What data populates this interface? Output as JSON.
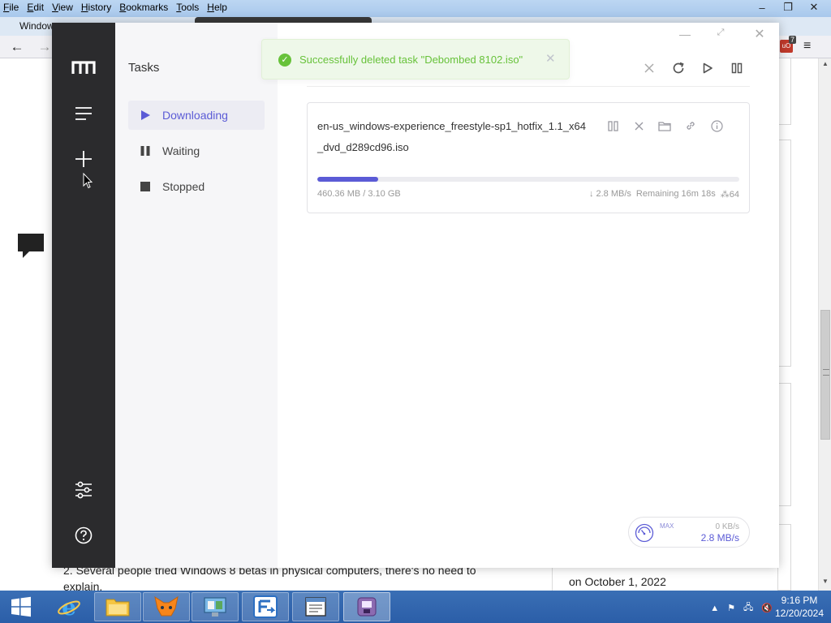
{
  "browser": {
    "menu": [
      "File",
      "Edit",
      "View",
      "History",
      "Bookmarks",
      "Tools",
      "Help"
    ],
    "tabs": [
      "Window"
    ],
    "back": "←",
    "forward": "→",
    "ublock_count": "7",
    "menu_button": "≡",
    "window_controls": [
      "‒",
      "❐",
      "✕"
    ]
  },
  "page": {
    "text": "2. Several people tried Windows 8 betas in physical computers, there's no need to explain.",
    "date": "on October 1, 2022"
  },
  "app": {
    "window_controls": {
      "minimize": "—",
      "maximize": "⤢",
      "close": "✕"
    },
    "sidebar": {
      "icons": [
        "motrix-logo-icon",
        "menu-icon",
        "add-icon",
        "preferences-icon",
        "help-icon"
      ]
    },
    "subnav": {
      "title": "Tasks",
      "items": [
        {
          "label": "Downloading",
          "icon": "play-icon",
          "active": true
        },
        {
          "label": "Waiting",
          "icon": "pause-icon",
          "active": false
        },
        {
          "label": "Stopped",
          "icon": "stop-icon",
          "active": false
        }
      ]
    },
    "toast": {
      "message": "Successfully deleted task \"Debombed 8102.iso\"",
      "color": "#67c23a"
    },
    "task": {
      "name": "en-us_windows-experience_freestyle-sp1_hotfix_1.1_x64_dvd_d289cd96.iso",
      "size": "460.36 MB / 3.10 GB",
      "speed": "↓ 2.8 MB/s",
      "remaining": "Remaining 16m 18s",
      "connections": "64",
      "progress": 0.145,
      "accent": "#5b5bd6"
    },
    "speedometer": {
      "label": "MAX",
      "upload": "0 KB/s",
      "download": "2.8 MB/s"
    }
  },
  "taskbar": {
    "time": "9:16 PM",
    "date": "12/20/2024",
    "apps": [
      "internet-explorer",
      "file-explorer",
      "metamask",
      "control-panel",
      "freefilesync",
      "notepad",
      "motrix"
    ]
  }
}
